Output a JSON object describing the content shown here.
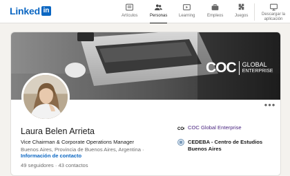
{
  "brand": {
    "wordmark": "Linked",
    "box": "in"
  },
  "nav": {
    "items": [
      {
        "label": "Artículos",
        "icon": "articles-icon"
      },
      {
        "label": "Personas",
        "icon": "people-icon",
        "active": true
      },
      {
        "label": "Learning",
        "icon": "learning-icon"
      },
      {
        "label": "Empleos",
        "icon": "jobs-icon"
      },
      {
        "label": "Juegos",
        "icon": "games-icon"
      }
    ],
    "download": {
      "line1": "Descargar la",
      "line2": "aplicación",
      "icon": "monitor-icon"
    }
  },
  "cover": {
    "brand_main": "COC",
    "brand_line1": "GLOBAL",
    "brand_line2": "ENTERPRISE"
  },
  "profile": {
    "name": "Laura Belen Arrieta",
    "headline": "Vice Chairman & Corporate Operations Manager",
    "location": "Buenos Aires, Provincia de Buenos Aires, Argentina",
    "separator": "·",
    "contact_link": "Información de contacto",
    "followers": "49 seguidores",
    "connections": "43 contactos",
    "more_icon": "•••"
  },
  "experience": [
    {
      "label": "COC Global Enterprise",
      "icon": "company-logo-icon"
    },
    {
      "label_line1": "CEDEBA - Centro de Estudios",
      "label_line2": "Buenos Aires",
      "icon": "school-logo-icon"
    }
  ],
  "colors": {
    "accent": "#0a66c2",
    "company": "#4a2580",
    "page_bg": "#f4f2ee"
  }
}
